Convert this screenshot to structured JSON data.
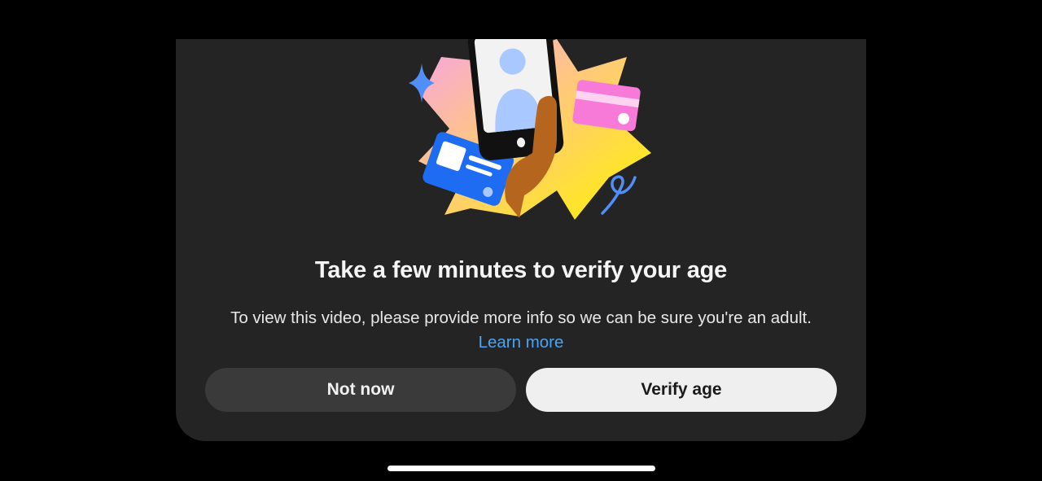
{
  "dialog": {
    "title": "Take a few minutes to verify your age",
    "description": "To view this video, please provide more info so we can be sure you're an adult.",
    "learn_more_label": "Learn more",
    "illustration": {
      "icons": [
        "sparkle-icon",
        "id-card-icon",
        "phone-with-portrait-icon",
        "hand-icon",
        "credit-card-icon",
        "squiggle-icon"
      ]
    }
  },
  "actions": {
    "secondary_label": "Not now",
    "primary_label": "Verify age"
  },
  "colors": {
    "sheet_background": "#242424",
    "link": "#4aa4f5",
    "secondary_button": "#3a3a3a",
    "primary_button": "#efefef"
  }
}
